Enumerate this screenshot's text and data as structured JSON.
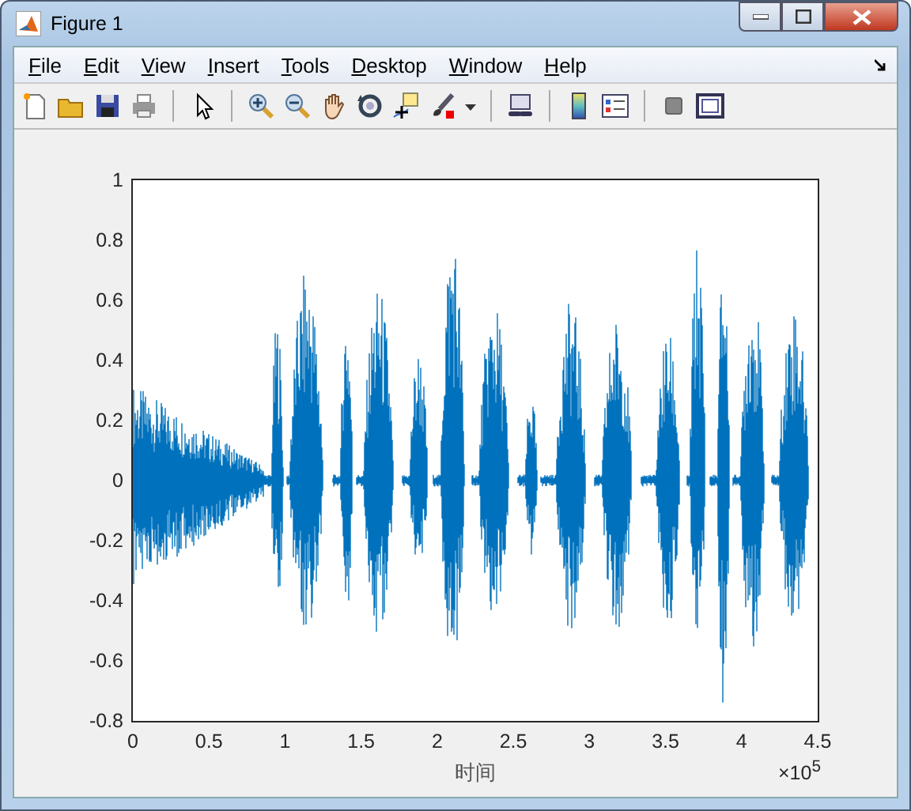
{
  "window": {
    "title": "Figure 1"
  },
  "menu": [
    "File",
    "Edit",
    "View",
    "Insert",
    "Tools",
    "Desktop",
    "Window",
    "Help"
  ],
  "axes": {
    "yticks": [
      "1",
      "0.8",
      "0.6",
      "0.4",
      "0.2",
      "0",
      "-0.2",
      "-0.4",
      "-0.6",
      "-0.8"
    ],
    "xticks": [
      "0",
      "0.5",
      "1",
      "1.5",
      "2",
      "2.5",
      "3",
      "3.5",
      "4",
      "4.5"
    ],
    "xlabel": "时间",
    "x_exponent": "×10$^{5}$"
  }
}
